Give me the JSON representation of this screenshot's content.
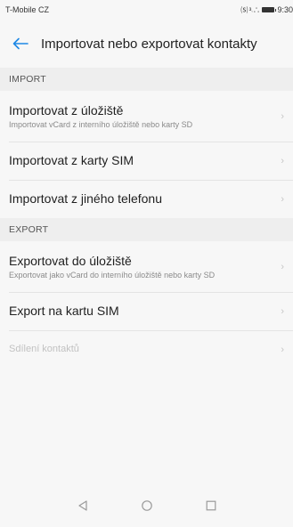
{
  "status_bar": {
    "carrier": "T-Mobile CZ",
    "icons": "⒮ ³˓∴",
    "time": "9:30"
  },
  "app_bar": {
    "back_icon": "arrow-left-icon",
    "title": "Importovat nebo exportovat kontakty",
    "accent_color": "#1e88e5"
  },
  "sections": {
    "import": {
      "header": "IMPORT",
      "items": [
        {
          "title": "Importovat z úložiště",
          "subtitle": "Importovat vCard z interního úložiště nebo karty SD"
        },
        {
          "title": "Importovat z karty SIM"
        },
        {
          "title": "Importovat z jiného telefonu"
        }
      ]
    },
    "export": {
      "header": "EXPORT",
      "items": [
        {
          "title": "Exportovat do úložiště",
          "subtitle": "Exportovat jako vCard do interního úložiště nebo karty SD"
        },
        {
          "title": "Export na kartu SIM"
        },
        {
          "title": "Sdílení kontaktů",
          "disabled": true
        }
      ]
    }
  },
  "chevron_glyph": "›",
  "nav_bar": {
    "back_icon": "triangle-back-icon",
    "home_icon": "circle-home-icon",
    "recents_icon": "square-recents-icon"
  }
}
